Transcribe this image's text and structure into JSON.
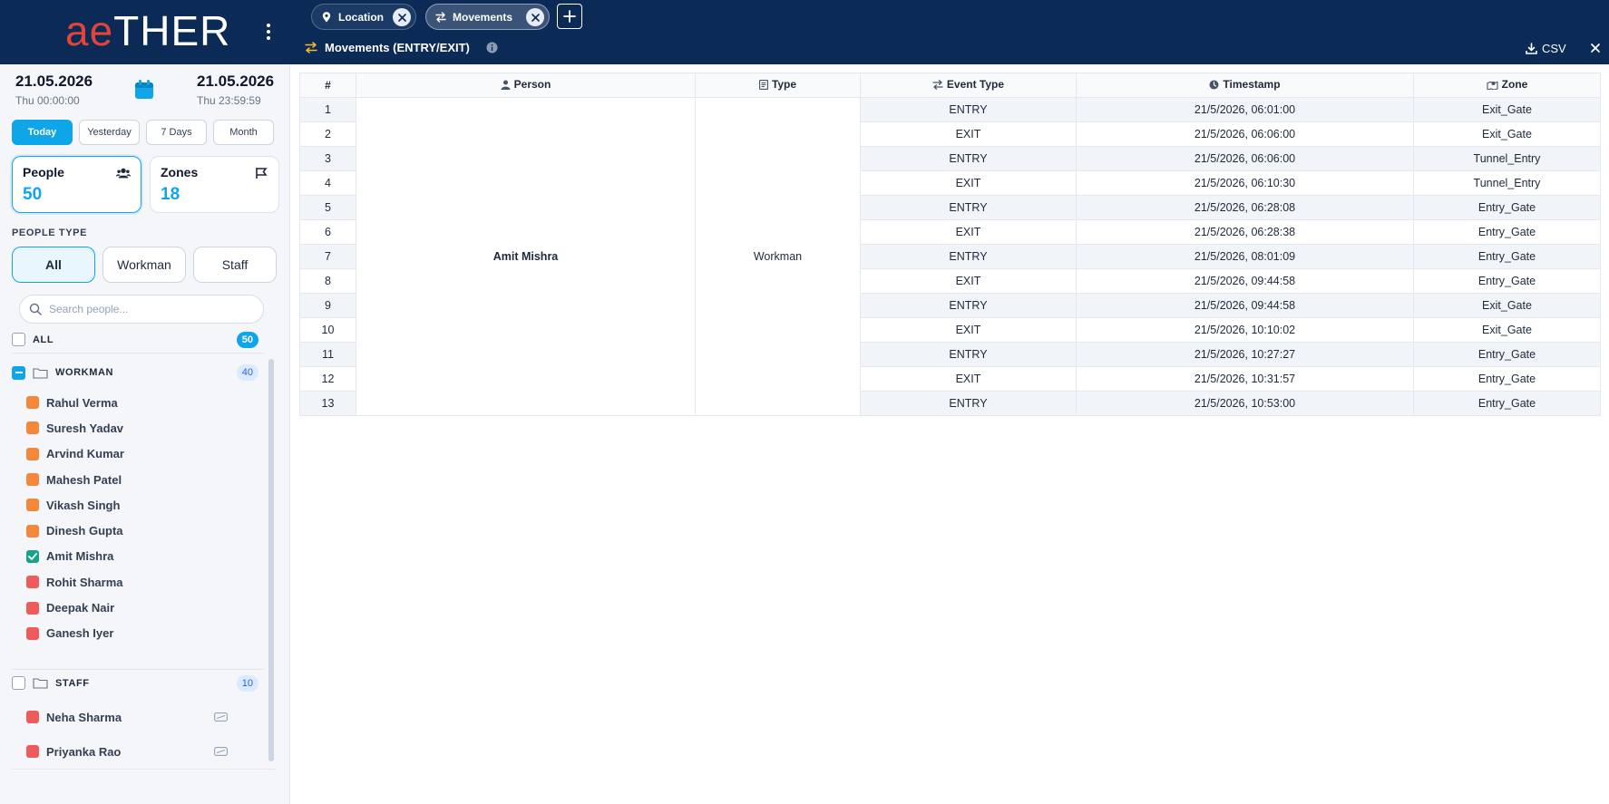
{
  "brand": {
    "ae": "ae",
    "rest": "THER"
  },
  "date_range": {
    "start_date": "21.05.2026",
    "start_time": "Thu 00:00:00",
    "end_date": "21.05.2026",
    "end_time": "Thu 23:59:59"
  },
  "quick_ranges": [
    {
      "label": "Today",
      "active": true
    },
    {
      "label": "Yesterday",
      "active": false
    },
    {
      "label": "7 Days",
      "active": false
    },
    {
      "label": "Month",
      "active": false
    }
  ],
  "stats": {
    "people": {
      "label": "People",
      "value": "50"
    },
    "zones": {
      "label": "Zones",
      "value": "18"
    }
  },
  "people_type": {
    "label": "PEOPLE TYPE",
    "options": [
      {
        "label": "All",
        "active": true
      },
      {
        "label": "Workman",
        "active": false
      },
      {
        "label": "Staff",
        "active": false
      }
    ]
  },
  "search": {
    "placeholder": "Search people..."
  },
  "groups": {
    "all": {
      "label": "ALL",
      "count": "50"
    },
    "workman": {
      "label": "WORKMAN",
      "count": "40"
    },
    "staff": {
      "label": "STAFF",
      "count": "10"
    }
  },
  "workman_people": [
    {
      "name": "Rahul Verma",
      "color": "#f5873a",
      "checked": false
    },
    {
      "name": "Suresh Yadav",
      "color": "#f5873a",
      "checked": false
    },
    {
      "name": "Arvind Kumar",
      "color": "#f5873a",
      "checked": false
    },
    {
      "name": "Mahesh Patel",
      "color": "#f5873a",
      "checked": false
    },
    {
      "name": "Vikash Singh",
      "color": "#f5873a",
      "checked": false
    },
    {
      "name": "Dinesh Gupta",
      "color": "#f5873a",
      "checked": false
    },
    {
      "name": "Amit Mishra",
      "color": "#14a38b",
      "checked": true
    },
    {
      "name": "Rohit Sharma",
      "color": "#ef5a5a",
      "checked": false
    },
    {
      "name": "Deepak Nair",
      "color": "#ef5a5a",
      "checked": false
    },
    {
      "name": "Ganesh Iyer",
      "color": "#ef5a5a",
      "checked": false
    }
  ],
  "staff_people": [
    {
      "name": "Neha Sharma",
      "color": "#ef5a5a"
    },
    {
      "name": "Priyanka Rao",
      "color": "#ef5a5a"
    }
  ],
  "tabs": [
    {
      "label": "Location",
      "icon": "map-pin-icon",
      "active": false
    },
    {
      "label": "Movements",
      "icon": "swap-arrows-icon",
      "active": true
    }
  ],
  "panel": {
    "title": "Movements (ENTRY/EXIT)",
    "csv_label": "CSV"
  },
  "table": {
    "headers": [
      "#",
      "Person",
      "Type",
      "Event Type",
      "Timestamp",
      "Zone"
    ],
    "person": "Amit Mishra",
    "type": "Workman",
    "rows": [
      {
        "n": "1",
        "event": "ENTRY",
        "ts": "21/5/2026, 06:01:00",
        "zone": "Exit_Gate"
      },
      {
        "n": "2",
        "event": "EXIT",
        "ts": "21/5/2026, 06:06:00",
        "zone": "Exit_Gate"
      },
      {
        "n": "3",
        "event": "ENTRY",
        "ts": "21/5/2026, 06:06:00",
        "zone": "Tunnel_Entry"
      },
      {
        "n": "4",
        "event": "EXIT",
        "ts": "21/5/2026, 06:10:30",
        "zone": "Tunnel_Entry"
      },
      {
        "n": "5",
        "event": "ENTRY",
        "ts": "21/5/2026, 06:28:08",
        "zone": "Entry_Gate"
      },
      {
        "n": "6",
        "event": "EXIT",
        "ts": "21/5/2026, 06:28:38",
        "zone": "Entry_Gate"
      },
      {
        "n": "7",
        "event": "ENTRY",
        "ts": "21/5/2026, 08:01:09",
        "zone": "Entry_Gate"
      },
      {
        "n": "8",
        "event": "EXIT",
        "ts": "21/5/2026, 09:44:58",
        "zone": "Entry_Gate"
      },
      {
        "n": "9",
        "event": "ENTRY",
        "ts": "21/5/2026, 09:44:58",
        "zone": "Exit_Gate"
      },
      {
        "n": "10",
        "event": "EXIT",
        "ts": "21/5/2026, 10:10:02",
        "zone": "Exit_Gate"
      },
      {
        "n": "11",
        "event": "ENTRY",
        "ts": "21/5/2026, 10:27:27",
        "zone": "Entry_Gate"
      },
      {
        "n": "12",
        "event": "EXIT",
        "ts": "21/5/2026, 10:31:57",
        "zone": "Entry_Gate"
      },
      {
        "n": "13",
        "event": "ENTRY",
        "ts": "21/5/2026, 10:53:00",
        "zone": "Entry_Gate"
      }
    ]
  },
  "colors": {
    "navy": "#0b2a55",
    "accent": "#0ea5e9",
    "brand_red": "#e0443b",
    "checked_green": "#14a38b"
  }
}
